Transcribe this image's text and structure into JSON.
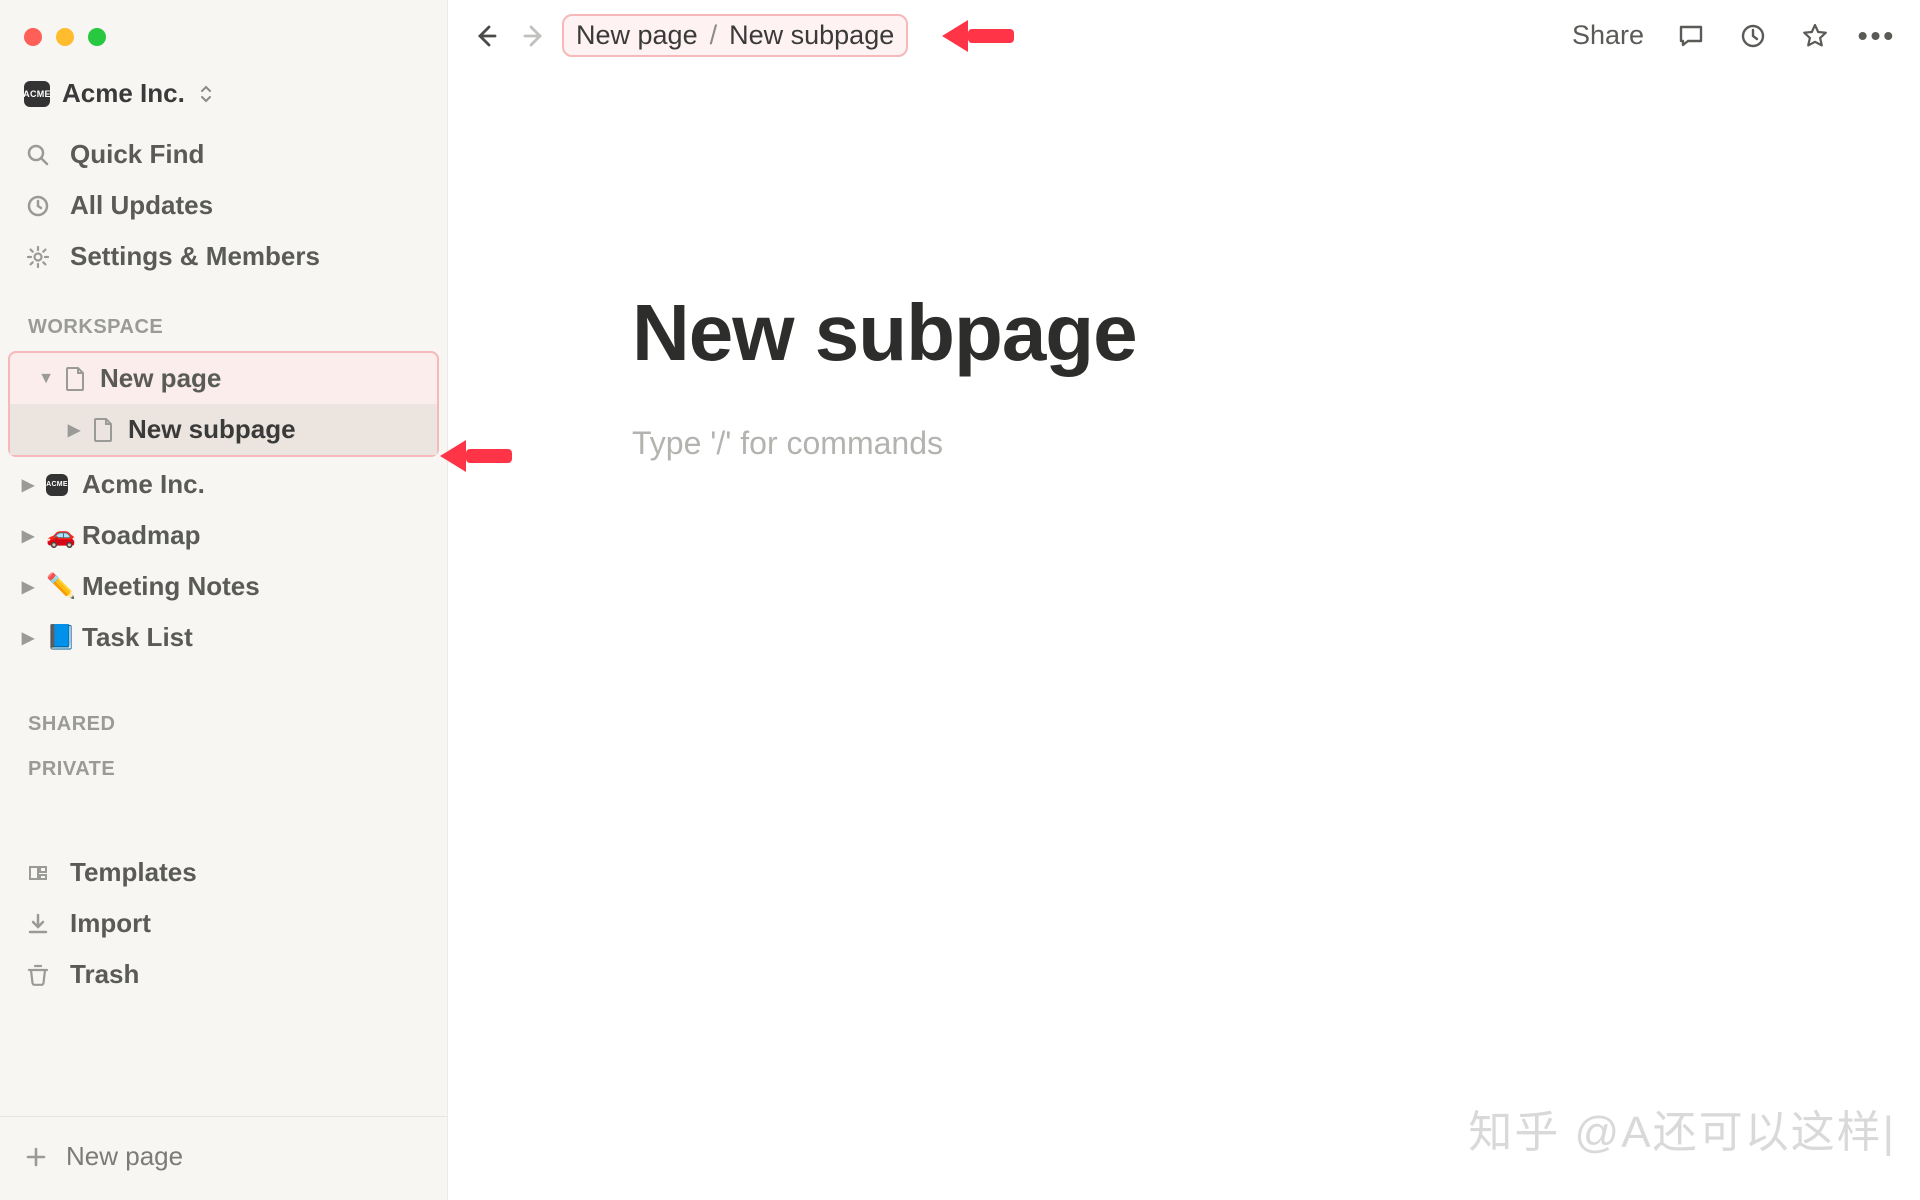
{
  "workspace": {
    "badge_text": "ACME",
    "name": "Acme Inc."
  },
  "sidebar": {
    "quick_find": "Quick Find",
    "all_updates": "All Updates",
    "settings": "Settings & Members",
    "section_workspace": "WORKSPACE",
    "section_shared": "SHARED",
    "section_private": "PRIVATE",
    "pages": {
      "new_page": "New page",
      "new_subpage": "New subpage",
      "acme_badge": "ACME",
      "acme": "Acme Inc.",
      "roadmap_emoji": "🚗",
      "roadmap": "Roadmap",
      "meeting_emoji": "✏️",
      "meeting": "Meeting Notes",
      "tasklist_emoji": "📘",
      "tasklist": "Task List"
    },
    "templates": "Templates",
    "import": "Import",
    "trash": "Trash",
    "new_page_footer": "New page"
  },
  "topbar": {
    "share": "Share"
  },
  "breadcrumb": {
    "parent": "New page",
    "sep": "/",
    "child": "New subpage"
  },
  "document": {
    "title": "New subpage",
    "placeholder": "Type '/' for commands"
  },
  "watermark": "知乎 @A还可以这样|"
}
